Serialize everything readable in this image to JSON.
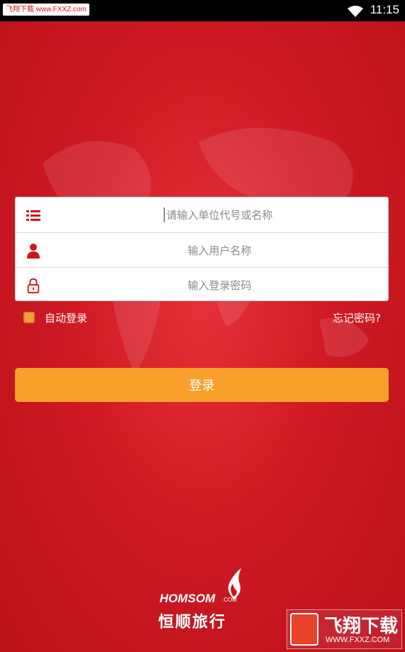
{
  "status_bar": {
    "watermark": "飞翔下载 www.FXXZ.com",
    "time": "11:15",
    "wifi_icon": "wifi-icon"
  },
  "form": {
    "company_placeholder": "请输入单位代号或名称",
    "username_placeholder": "输入用户名称",
    "password_placeholder": "输入登录密码",
    "icons": [
      "list-icon",
      "user-icon",
      "lock-icon"
    ]
  },
  "options": {
    "auto_login_label": "自动登录",
    "forgot_password_label": "忘记密码?"
  },
  "login_button_label": "登录",
  "brand": {
    "name_en": "HOMSOM",
    "dotcom": ".COM",
    "name_cn": "恒顺旅行"
  },
  "corner_watermark": {
    "text": "飞翔下载",
    "url": "WWW.FXXZ.COM"
  },
  "colors": {
    "background": "#cf1a24",
    "accent": "#f9a02a",
    "icon_red": "#d0141c"
  }
}
